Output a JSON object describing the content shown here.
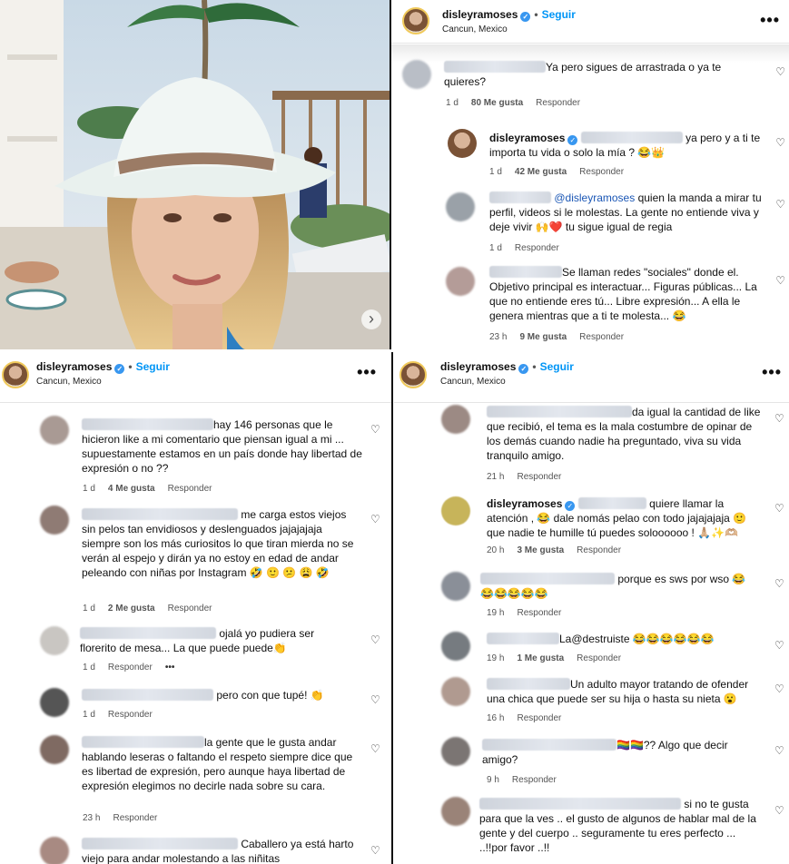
{
  "post": {
    "username": "disleyramoses",
    "location": "Cancun, Mexico",
    "follow_label": "Seguir",
    "dot": "•",
    "verified": "✓"
  },
  "common": {
    "reply": "Responder",
    "more": "•••",
    "heart": "♡",
    "next": "›"
  },
  "panel_tr": [
    {
      "text": "Ya pero sigues de arrastrada o ya te quieres?",
      "time": "1 d",
      "likes": "80 Me gusta"
    },
    {
      "user": "disleyramoses",
      "text": "ya pero y a ti te importa tu vida o solo la mía ? 😂👑",
      "time": "1 d",
      "likes": "42 Me gusta"
    },
    {
      "mention": "@disleyramoses",
      "text": "quien la manda a mirar tu perfil, videos si le molestas. La gente no entiende viva y deje vivir 🙌❤️ tu sigue igual de regia",
      "time": "1 d"
    },
    {
      "text": "Se llaman redes \"sociales\" donde el. Objetivo principal es interactuar... Figuras públicas... La que no entiende eres tú... Libre expresión... A ella le genera mientras que a ti te molesta... 😂",
      "time": "23 h",
      "likes": "9 Me gusta"
    }
  ],
  "panel_bl": [
    {
      "text": "hay 146 personas que le hicieron like a mi comentario que piensan igual a mi ... supuestamente estamos en un país donde hay libertad de expresión o no ??",
      "time": "1 d",
      "likes": "4 Me gusta"
    },
    {
      "text": "me carga estos viejos sin pelos tan envidiosos y deslenguados jajajajaja siempre son los más curiositos lo que tiran mierda no se verán al espejo y dirán ya no estoy en edad de andar peleando con niñas por Instagram 🤣 🙂 😕 😩 🤣",
      "time": "1 d",
      "likes": "2 Me gusta"
    },
    {
      "text": "ojalá yo pudiera ser florerito de mesa... La que puede puede👏",
      "time": "1 d"
    },
    {
      "text": "pero con que tupé! 👏",
      "time": "1 d"
    },
    {
      "text": "la gente que le gusta andar hablando leseras o faltando el respeto siempre dice que es libertad de expresión, pero aunque haya libertad de expresión elegimos no decirle nada sobre su cara.",
      "time": "23 h"
    },
    {
      "text": "Caballero ya está harto viejo para andar molestando a las niñitas"
    }
  ],
  "panel_br": [
    {
      "text": "da igual la cantidad de like que recibió, el tema es la mala costumbre de opinar de los demás cuando nadie ha preguntado, viva su vida tranquilo amigo.",
      "time": "21 h"
    },
    {
      "user": "disleyramoses",
      "text": "quiere llamar la atención , 😂 dale nomás pelao con todo jajajajaja 🙂 que nadie te humille tú puedes soloooooo ! 🙏🏼✨🫶🏼",
      "time": "20 h",
      "likes": "3 Me gusta"
    },
    {
      "text": "porque es sws por wso 😂 😂😂😂😂😂",
      "time": "19 h"
    },
    {
      "text": "La@destruiste 😂😂😂😂😂😂",
      "time": "19 h",
      "likes": "1 Me gusta"
    },
    {
      "text": "Un adulto mayor tratando de ofender una chica que puede ser su hija o hasta su nieta 😮",
      "time": "16 h"
    },
    {
      "text": "🏳️‍🌈🏳️‍🌈?? Algo que decir amigo?",
      "time": "9 h"
    },
    {
      "text": "si no te gusta para que la ves .. el gusto de algunos de hablar mal de la gente y del cuerpo .. seguramente tu eres perfecto ... ..!!por favor ..!!"
    }
  ]
}
